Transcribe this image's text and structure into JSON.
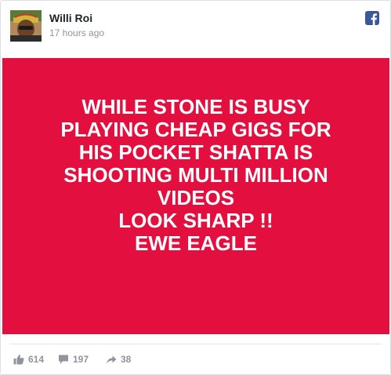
{
  "post": {
    "author": "Willi Roi",
    "timestamp": "17 hours ago",
    "image_text_lines": [
      "WHILE STONE IS BUSY",
      "PLAYING CHEAP GIGS FOR",
      "HIS POCKET SHATTA IS",
      "SHOOTING MULTI MILLION",
      "VIDEOS",
      "LOOK SHARP !!",
      "EWE EAGLE"
    ],
    "image_background": "#e3103f",
    "image_text_color": "#ffffff"
  },
  "stats": {
    "likes": "614",
    "comments": "197",
    "shares": "38"
  },
  "icons": {
    "platform": "facebook-icon",
    "like": "thumbs-up-icon",
    "comment": "speech-bubble-icon",
    "share": "share-arrow-icon"
  },
  "colors": {
    "facebook_blue": "#3b5998",
    "meta_gray": "#90949c",
    "author_text": "#1d2129"
  }
}
